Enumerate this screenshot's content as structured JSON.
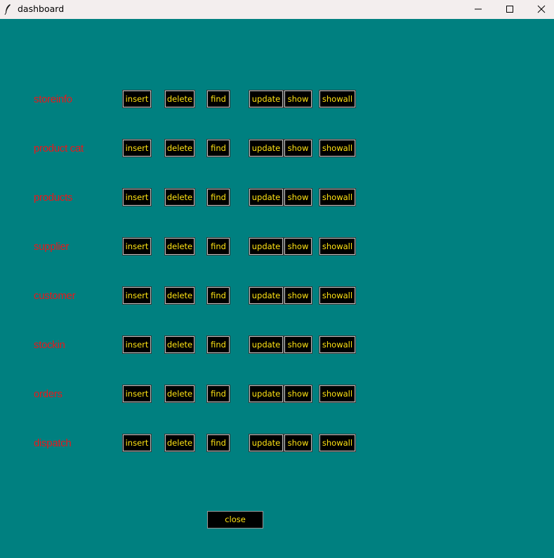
{
  "window": {
    "title": "dashboard"
  },
  "actions": {
    "insert": "insert",
    "delete": "delete",
    "find": "find",
    "update": "update",
    "show": "show",
    "showall": "showall"
  },
  "rows": [
    {
      "label": "storeinfo"
    },
    {
      "label": "product cat"
    },
    {
      "label": "products"
    },
    {
      "label": "supplier"
    },
    {
      "label": "customer"
    },
    {
      "label": "stockin"
    },
    {
      "label": "orders"
    },
    {
      "label": "dispatch"
    }
  ],
  "footer": {
    "close_label": "close"
  },
  "colors": {
    "background": "#008080",
    "label": "#e8181b",
    "button_bg": "#000000",
    "button_text": "#ffe313"
  }
}
